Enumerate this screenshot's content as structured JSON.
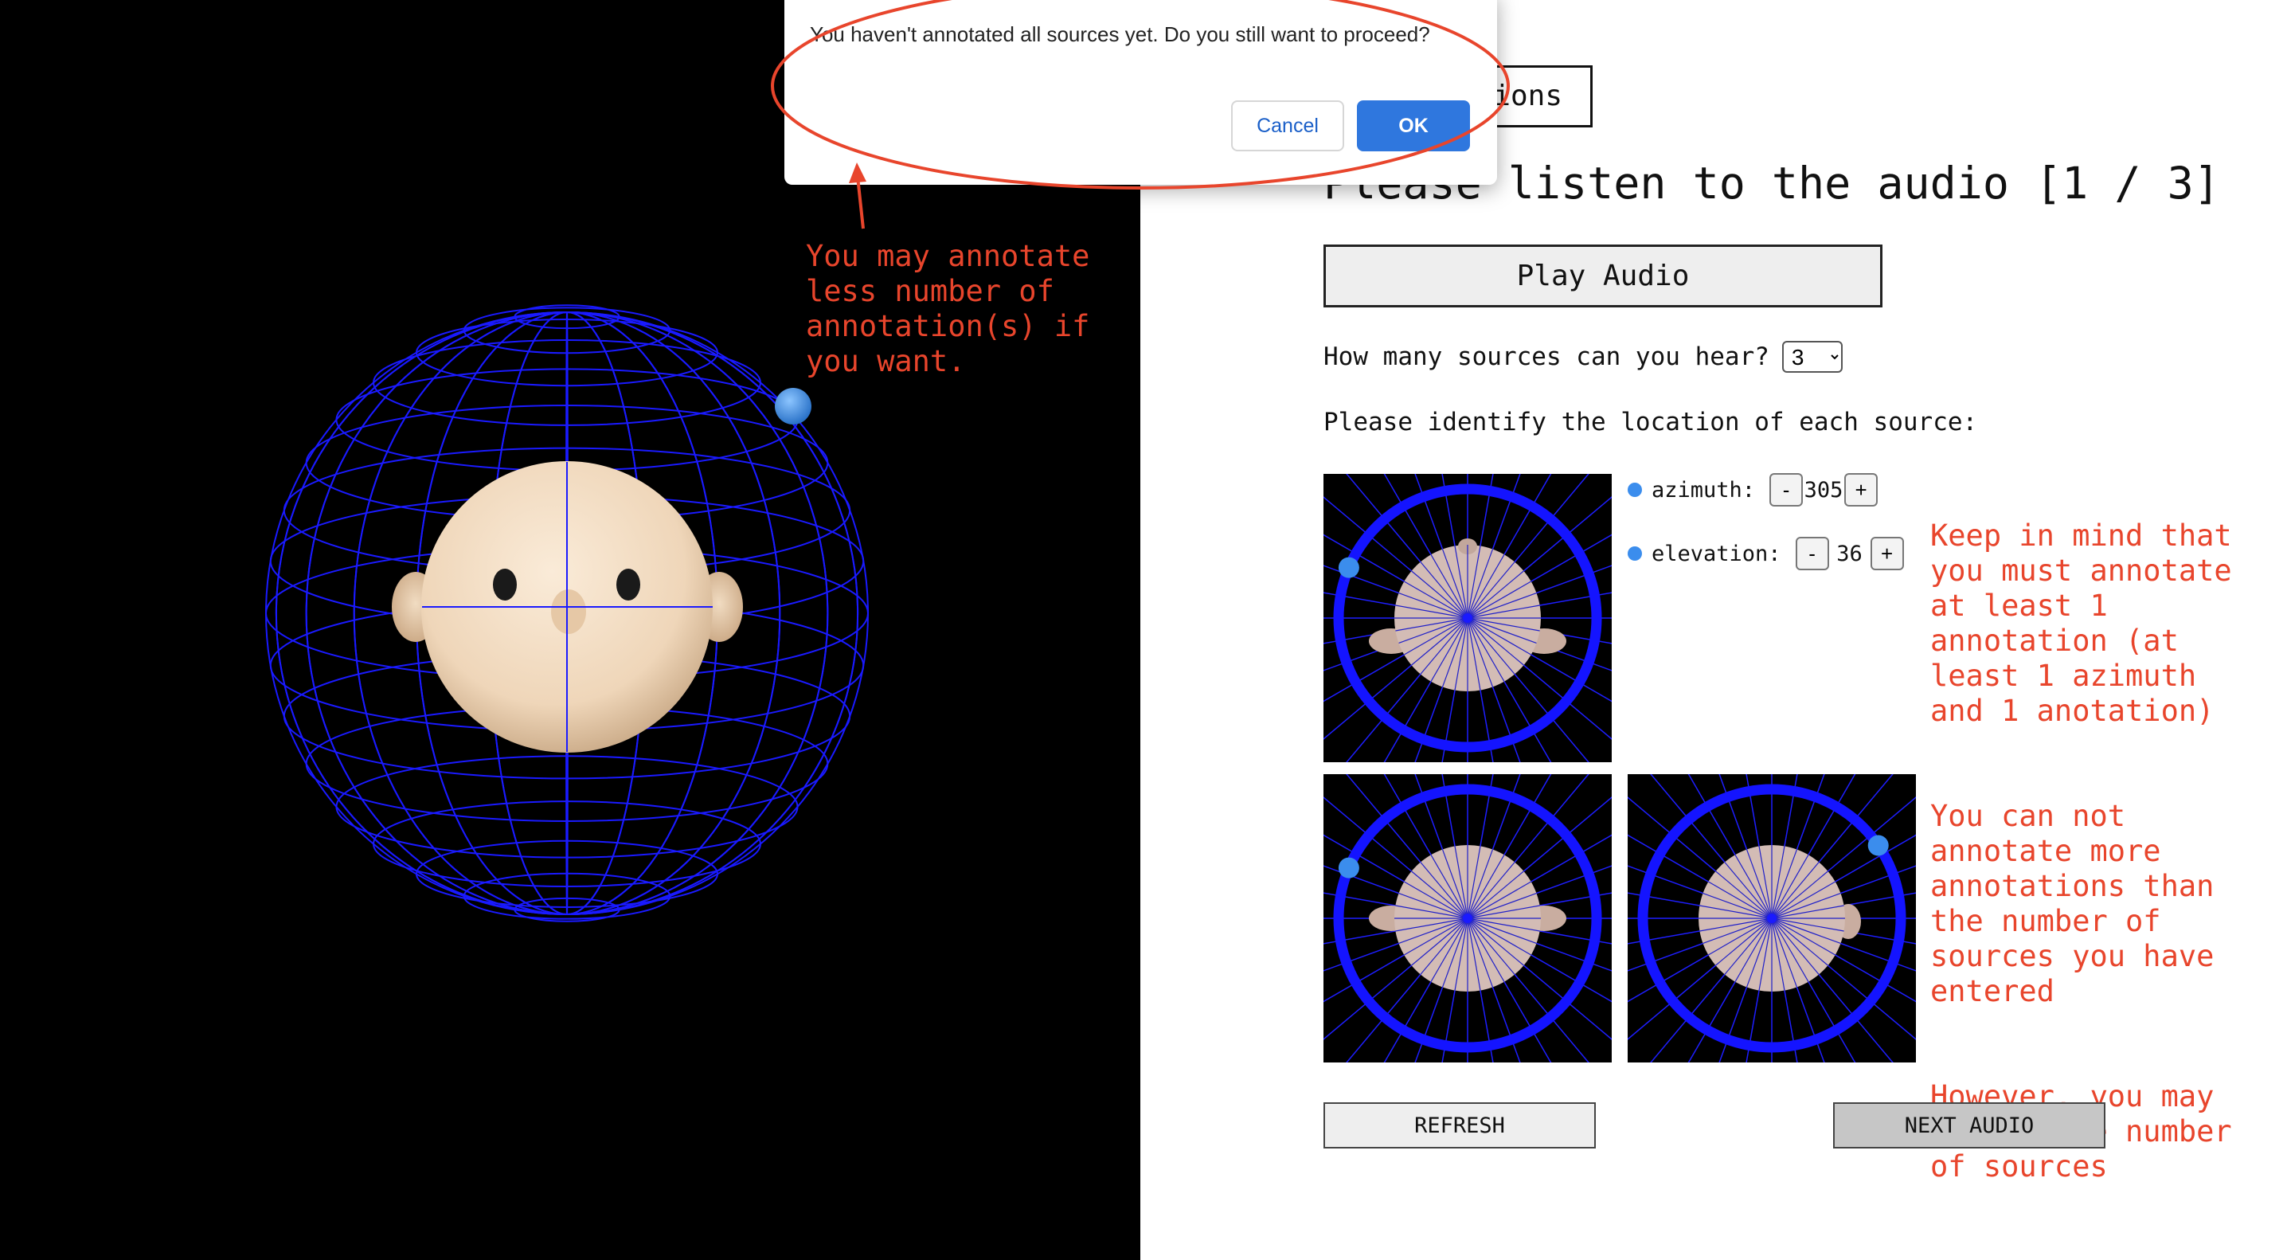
{
  "dialog": {
    "message": "You haven't annotated all sources yet. Do you still want to proceed?",
    "cancel_label": "Cancel",
    "ok_label": "OK"
  },
  "header": {
    "instructions_label": "ions",
    "title": "Please listen to the audio [1 / 3]"
  },
  "controls": {
    "play_label": "Play Audio",
    "sources_question": "How many sources can you hear?",
    "sources_value": "3",
    "location_prompt": "Please identify the location of each source:"
  },
  "source_1": {
    "azimuth_label": "azimuth:",
    "azimuth_value": "305",
    "elevation_label": "elevation:",
    "elevation_value": "36",
    "dot_color": "#3b8ded"
  },
  "buttons": {
    "minus": "-",
    "plus": "+",
    "refresh": "REFRESH",
    "next": "NEXT AUDIO"
  },
  "annotations": {
    "left_note": "You may annotate\nless number of\nannotation(s) if\nyou want.",
    "right_note_1": "Keep in mind that\nyou must annotate\nat least 1\nannotation (at\nleast 1 azimuth\nand 1 anotation)",
    "right_note_2": "You can not\nannotate more\nannotations than\nthe number of\nsources you have\nentered",
    "right_note_3": "However, you may\nchange the number\nof sources",
    "color": "#e8452c"
  },
  "icons": {
    "stepper": "plus-minus",
    "select": "chevron-down-icon"
  }
}
